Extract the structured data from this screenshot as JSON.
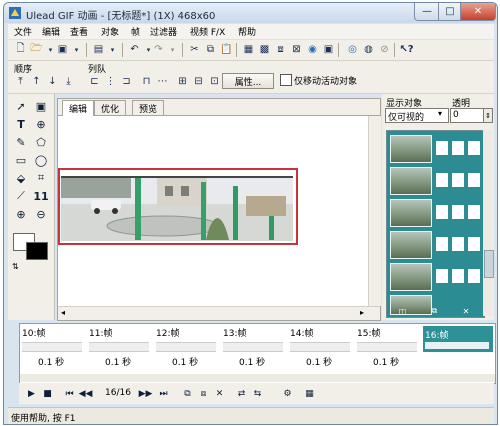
{
  "window": {
    "title": "Ulead GIF 动画 - [无标题*] (1X) 468x60",
    "min": "—",
    "max": "□",
    "close": "✕"
  },
  "menu": [
    "文件",
    "编辑",
    "查看",
    "对象",
    "帧",
    "过滤器",
    "视频 F/X",
    "帮助"
  ],
  "toolbar2": {
    "order_label": "顺序",
    "align_label": "列队",
    "attributes_button": "属性...",
    "move_only_active_label": "仅移动活动对象"
  },
  "editor": {
    "tabs": [
      "编辑",
      "优化",
      "预览"
    ],
    "active_tab": 0
  },
  "objects_panel": {
    "show_objects_label": "显示对象",
    "show_objects_value": "仅可视的",
    "opacity_label": "透明",
    "opacity_value": "0"
  },
  "frames": [
    {
      "label": "10:帧",
      "delay": "0.1 秒"
    },
    {
      "label": "11:帧",
      "delay": "0.1 秒"
    },
    {
      "label": "12:帧",
      "delay": "0.1 秒"
    },
    {
      "label": "13:帧",
      "delay": "0.1 秒"
    },
    {
      "label": "14:帧",
      "delay": "0.1 秒"
    },
    {
      "label": "15:帧",
      "delay": "0.1 秒"
    },
    {
      "label": "16:帧",
      "delay": "",
      "selected": true
    }
  ],
  "playback": {
    "counter": "16/16"
  },
  "status": "使用帮助, 按 F1",
  "colors": {
    "selection_rect": "#c6353b",
    "object_list_bg": "#2b8c93",
    "selected_frame_bg": "#2f9198"
  }
}
